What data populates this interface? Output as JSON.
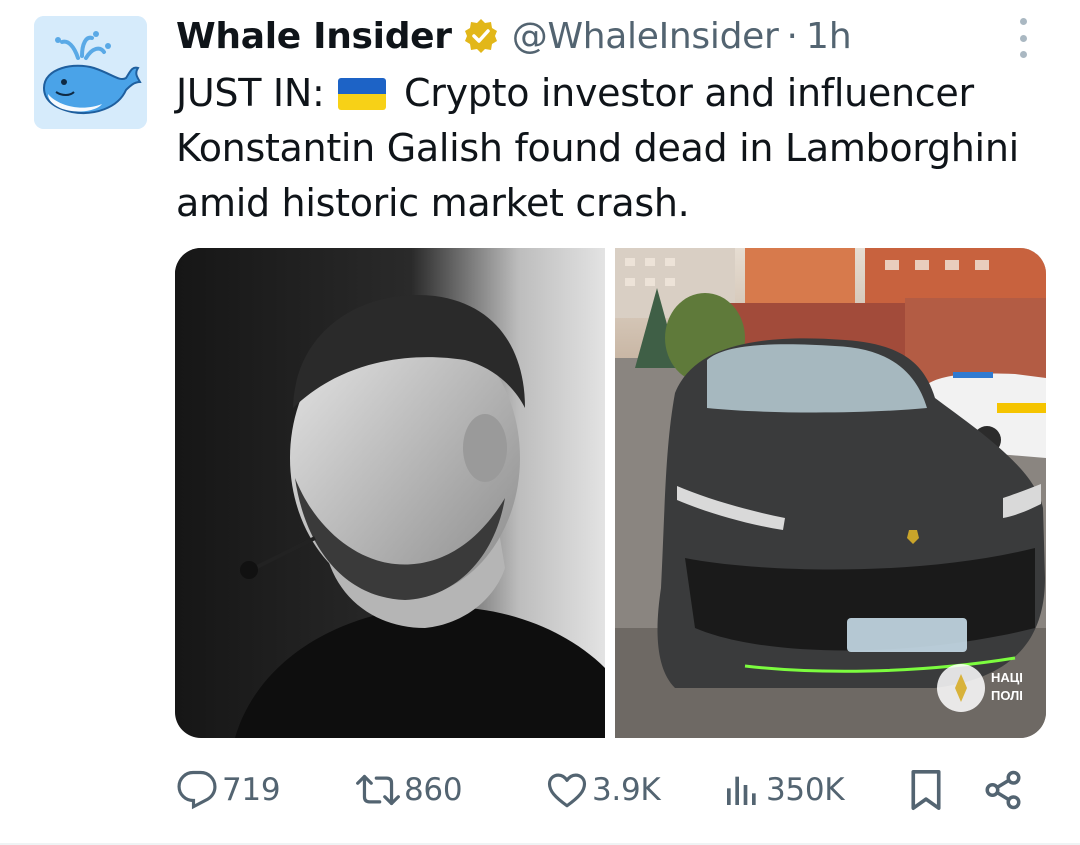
{
  "author": {
    "name": "Whale Insider",
    "handle": "@WhaleInsider",
    "separator": "·",
    "time": "1h",
    "badge_color": "#e2b719"
  },
  "tweet": {
    "prefix": "JUST IN:",
    "flag_icon": "ukraine-flag-icon",
    "body": "Crypto investor and influencer Konstantin Galish found dead in Lamborghini amid historic market crash."
  },
  "media": {
    "images": [
      {
        "name": "portrait-photo",
        "description_icon": "photo"
      },
      {
        "name": "lamborghini-photo",
        "description_icon": "photo",
        "watermark_text": "НАЦІ ПОЛІ"
      }
    ]
  },
  "actions": {
    "replies": "719",
    "reposts": "860",
    "likes": "3.9K",
    "views": "350K",
    "icons": [
      "reply-icon",
      "repost-icon",
      "like-icon",
      "views-icon",
      "bookmark-icon",
      "share-icon"
    ]
  },
  "colors": {
    "text": "#0f1419",
    "muted": "#536471",
    "accent": "#1d9bf0"
  }
}
